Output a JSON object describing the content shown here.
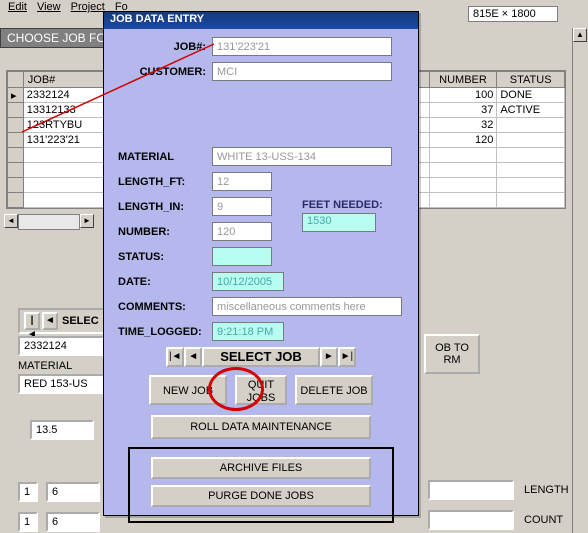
{
  "menubar": [
    "Edit",
    "View",
    "Project",
    "Fo"
  ],
  "chooser_label": "CHOOSE JOB FOR ROL",
  "size_indicator": "815E × 1800",
  "grid": {
    "columns": [
      "JOB#",
      "NUMBER",
      "STATUS"
    ],
    "rows": [
      {
        "job": "2332124",
        "number": "100",
        "status": "DONE"
      },
      {
        "job": "13312133",
        "number": "37",
        "status": "ACTIVE"
      },
      {
        "job": "123RTYBU",
        "number": "32",
        "status": ""
      },
      {
        "job": "131'223'21",
        "number": "120",
        "status": ""
      }
    ]
  },
  "bg": {
    "select_label": "SELEC",
    "job_value": "2332124",
    "material_label": "MATERIAL",
    "material_value": "RED 153-US",
    "num1": "13.5",
    "s1": "1",
    "s2": "6",
    "s3": "1",
    "s4": "6",
    "job_to_rm": "OB TO\nRM",
    "length_label": "LENGTH",
    "count_label": "COUNT"
  },
  "dialog": {
    "title": "JOB DATA ENTRY",
    "jobnum_label": "JOB#:",
    "jobnum": "131'223'21",
    "customer_label": "CUSTOMER:",
    "customer": "MCI",
    "material_label": "MATERIAL",
    "material": "WHITE 13-USS-134",
    "length_ft_label": "LENGTH_FT:",
    "length_ft": "12",
    "length_in_label": "LENGTH_IN:",
    "length_in": "9",
    "number_label": "NUMBER:",
    "number": "120",
    "status_label": "STATUS:",
    "status": "",
    "date_label": "DATE:",
    "date": "10/12/2005",
    "comments_label": "COMMENTS:",
    "comments": "miscellaneous comments here",
    "time_logged_label": "TIME_LOGGED:",
    "time_logged": "9:21:18 PM",
    "feet_needed_label": "FEET NEEDED:",
    "feet_needed": "1530",
    "select_job": "SELECT JOB",
    "new_job": "NEW JOB",
    "quit_jobs": "QUIT\nJOBS",
    "delete_job": "DELETE JOB",
    "roll_maint": "ROLL  DATA  MAINTENANCE",
    "archive": "ARCHIVE FILES",
    "purge": "PURGE DONE JOBS"
  }
}
